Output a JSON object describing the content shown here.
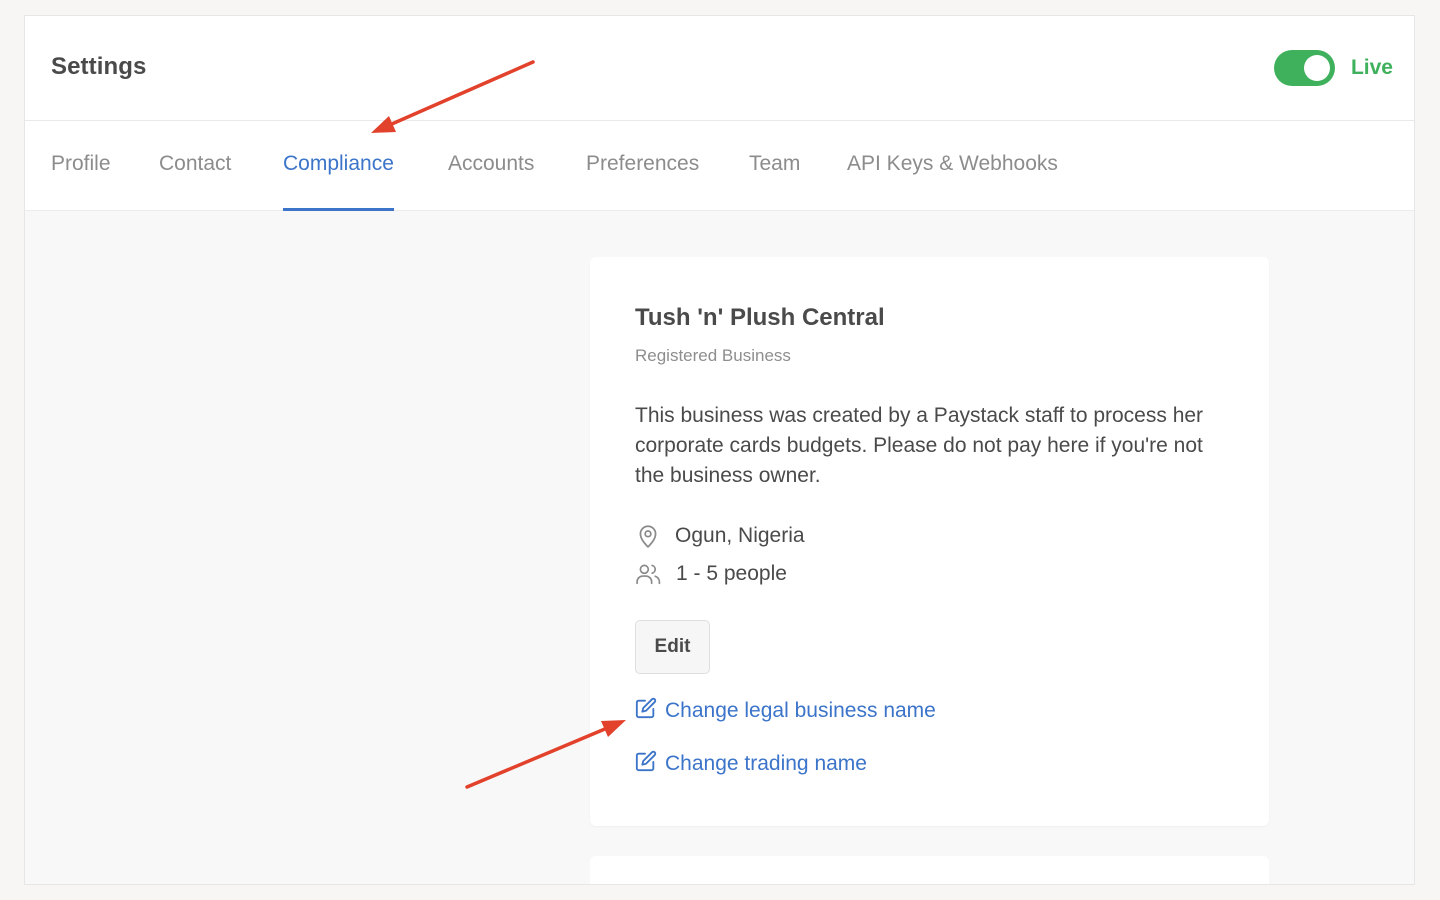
{
  "header": {
    "title": "Settings",
    "mode_label": "Live",
    "mode_enabled": true
  },
  "tabs": [
    {
      "label": "Profile",
      "active": false
    },
    {
      "label": "Contact",
      "active": false
    },
    {
      "label": "Compliance",
      "active": true
    },
    {
      "label": "Accounts",
      "active": false
    },
    {
      "label": "Preferences",
      "active": false
    },
    {
      "label": "Team",
      "active": false
    },
    {
      "label": "API Keys & Webhooks",
      "active": false
    }
  ],
  "business": {
    "name": "Tush 'n' Plush Central",
    "type": "Registered Business",
    "description": "This business was created by a Paystack staff to process her corporate cards budgets. Please do not pay here if you're not the business owner.",
    "location": "Ogun, Nigeria",
    "location_icon": "map-pin-icon",
    "team_size": "1 - 5 people",
    "team_icon": "users-icon",
    "edit_label": "Edit",
    "links": {
      "change_legal_name": "Change legal business name",
      "change_trading_name": "Change trading name"
    }
  },
  "colors": {
    "accent": "#3b74c9",
    "live_green": "#3fb15d",
    "annotation_arrow": "#e2412b"
  }
}
